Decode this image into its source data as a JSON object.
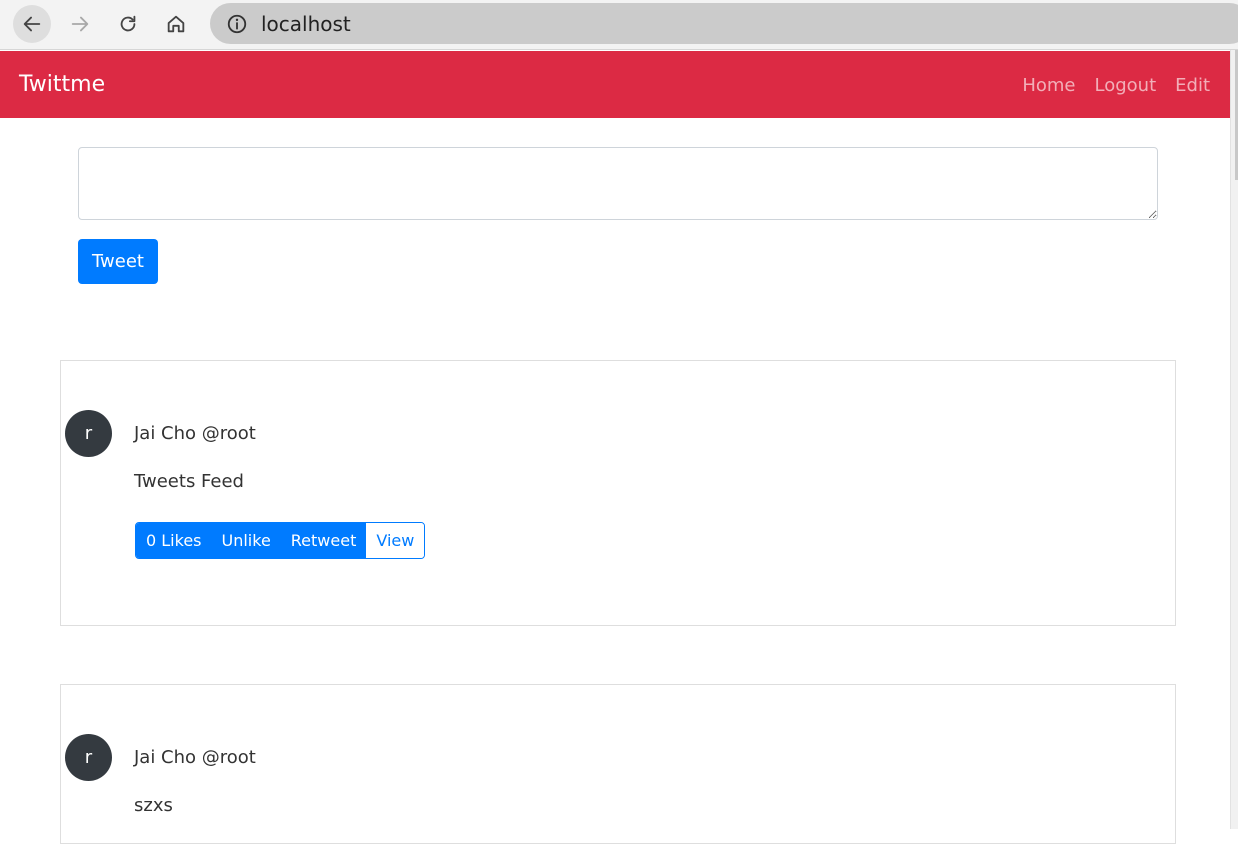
{
  "browser": {
    "url": "localhost"
  },
  "navbar": {
    "brand": "Twittme",
    "links": [
      "Home",
      "Logout",
      "Edit"
    ],
    "color": "#dc2a44"
  },
  "composer": {
    "value": "",
    "button_label": "Tweet"
  },
  "tweets": [
    {
      "avatar_letter": "r",
      "author": "Jai Cho @root",
      "text": "Tweets Feed",
      "actions": [
        "0 Likes",
        "Unlike",
        "Retweet",
        "View"
      ]
    },
    {
      "avatar_letter": "r",
      "author": "Jai Cho @root",
      "text": "szxs"
    }
  ]
}
